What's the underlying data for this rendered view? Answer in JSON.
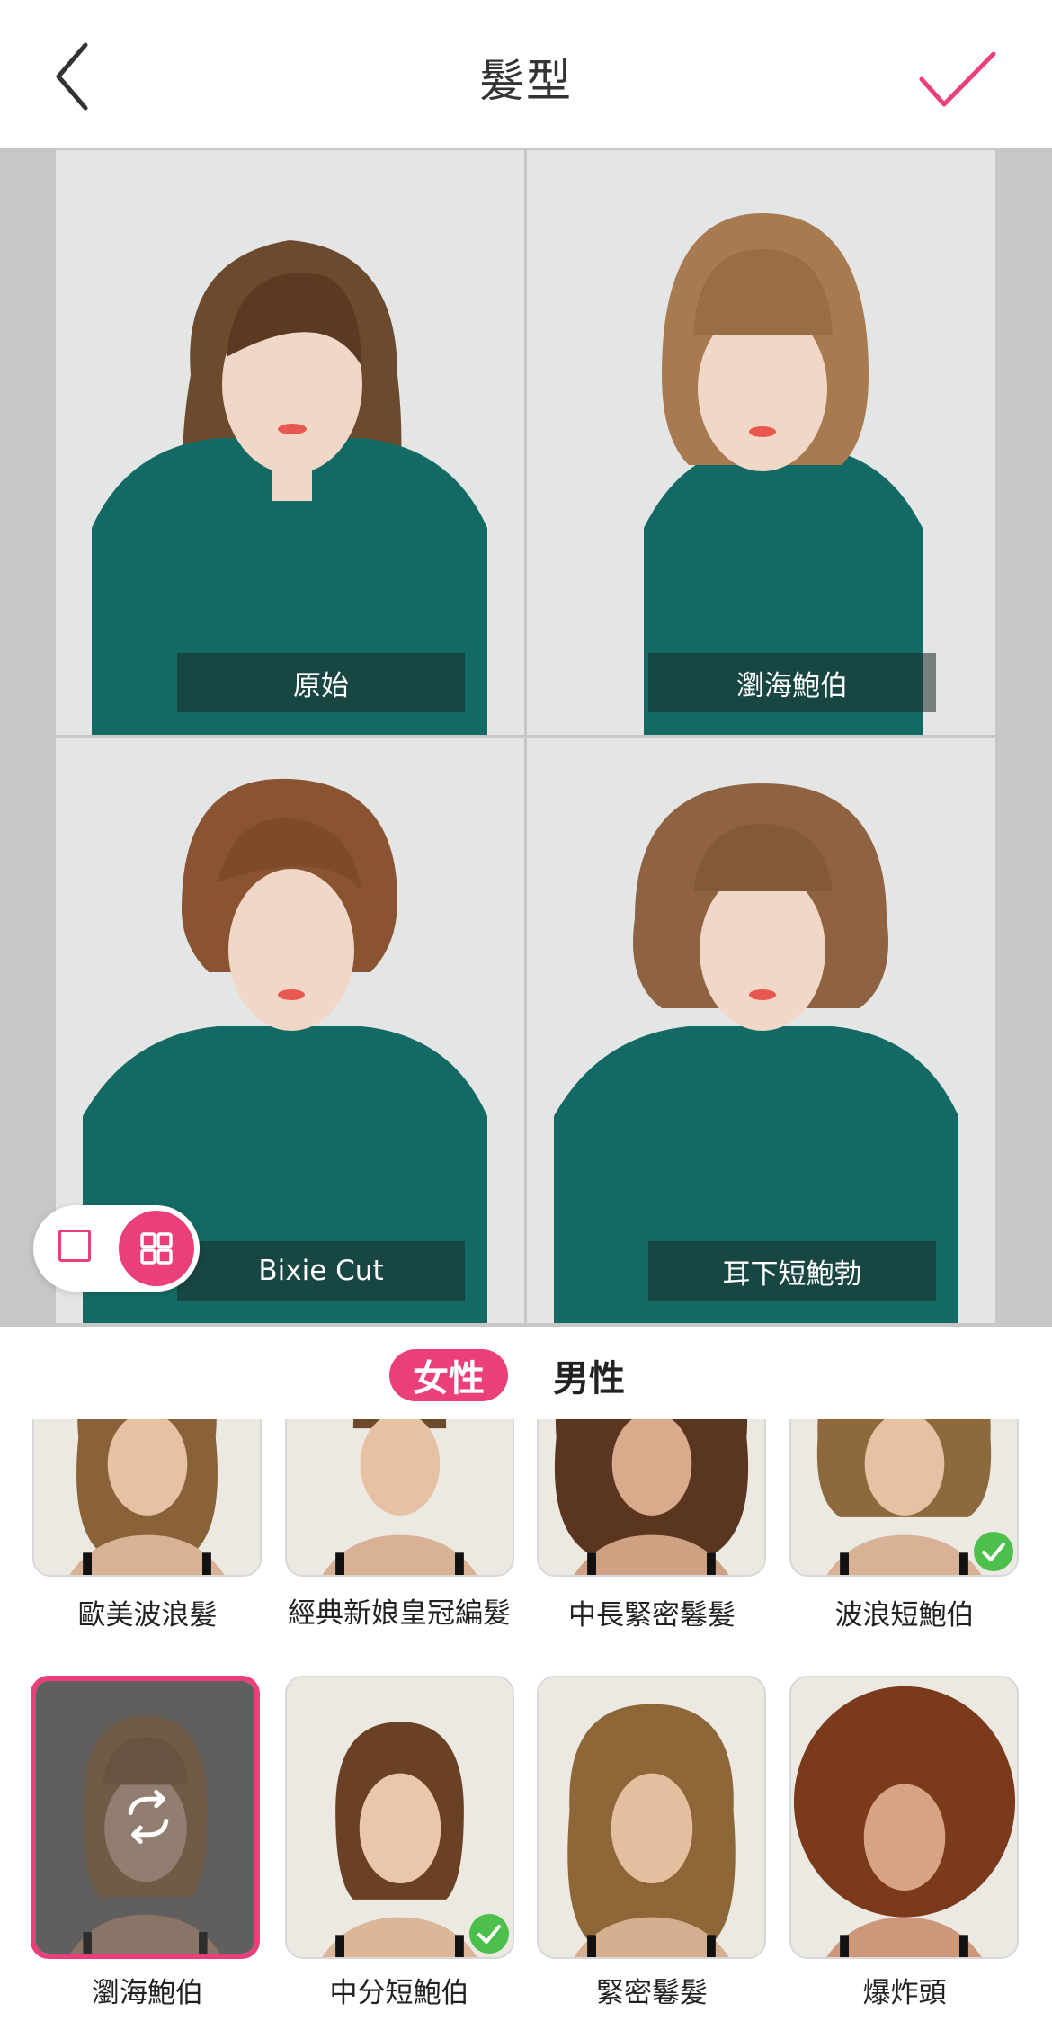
{
  "header": {
    "title": "髮型",
    "back_icon": "chevron-left-icon",
    "confirm_icon": "checkmark-icon"
  },
  "accent_color": "#ea3f7b",
  "preview": {
    "cells": [
      {
        "label": "原始",
        "selected": false
      },
      {
        "label": "瀏海鮑伯",
        "selected": true
      },
      {
        "label": "Bixie Cut",
        "selected": false
      },
      {
        "label": "耳下短鮑勃",
        "selected": false
      }
    ],
    "view_toggle": {
      "single_icon": "single-view-icon",
      "grid_icon": "grid-view-icon",
      "active": "grid"
    }
  },
  "gender_tabs": {
    "female": "女性",
    "male": "男性",
    "active": "female"
  },
  "styles": {
    "row1": [
      {
        "label": "歐美波浪髮",
        "applied": false
      },
      {
        "label": "經典新娘皇冠編髮",
        "applied": false
      },
      {
        "label": "中長緊密鬈髮",
        "applied": false
      },
      {
        "label": "波浪短鮑伯",
        "applied": true
      }
    ],
    "row2": [
      {
        "label": "瀏海鮑伯",
        "applied": false,
        "active": true
      },
      {
        "label": "中分短鮑伯",
        "applied": true
      },
      {
        "label": "緊密鬈髮",
        "applied": false
      },
      {
        "label": "爆炸頭",
        "applied": false
      }
    ]
  }
}
